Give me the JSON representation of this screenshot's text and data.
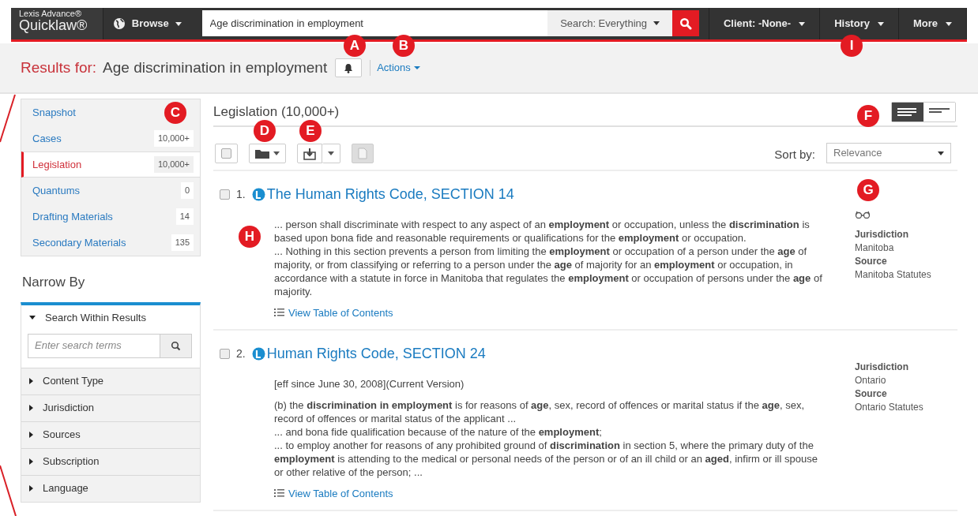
{
  "header": {
    "logo_line1": "Lexis Advance®",
    "logo_line2": "Quicklaw®",
    "browse": "Browse",
    "search_value": "Age discrimination in employment",
    "search_scope": "Search: Everything",
    "menus": [
      "Client: -None-",
      "History",
      "More"
    ]
  },
  "results_bar": {
    "label": "Results for:",
    "query": "Age discrimination in employment",
    "actions": "Actions"
  },
  "categories": [
    {
      "label": "Snapshot",
      "selected": false
    },
    {
      "label": "Cases",
      "count": "10,000+",
      "selected": false
    },
    {
      "label": "Legislation",
      "count": "10,000+",
      "selected": true
    },
    {
      "label": "Quantums",
      "count": "0",
      "selected": false
    },
    {
      "label": "Drafting Materials",
      "count": "14",
      "selected": false
    },
    {
      "label": "Secondary Materials",
      "count": "135",
      "selected": false
    }
  ],
  "narrow_by": {
    "title": "Narrow By",
    "search_placeholder": "Enter search terms",
    "sections": [
      {
        "label": "Search Within Results",
        "expanded": true
      },
      {
        "label": "Content Type",
        "expanded": false
      },
      {
        "label": "Jurisdiction",
        "expanded": false
      },
      {
        "label": "Sources",
        "expanded": false
      },
      {
        "label": "Subscription",
        "expanded": false
      },
      {
        "label": "Language",
        "expanded": false
      }
    ]
  },
  "results_header": {
    "title": "Legislation (10,000+)",
    "sort_label": "Sort by:",
    "sort_value": "Relevance",
    "views": [
      {
        "kind": "full",
        "selected": true
      },
      {
        "kind": "list",
        "selected": false
      }
    ]
  },
  "results": [
    {
      "number": "1.",
      "title": "The Human Rights Code, SECTION 14",
      "checked": false,
      "has_preview": true,
      "snippets": [
        "... person shall discriminate with respect to any aspect of an **employment** or occupation, unless the **discrimination** is based upon bona fide and reasonable requirements or qualifications for the **employment** or occupation.",
        "... Nothing in this section prevents a person from limiting the **employment** or occupation of a person under the **age** of majority, or from classifying or referring to a person under the **age** of majority for an **employment** or occupation, in accordance with a statute in force in Manitoba that regulates the **employment** or occupation of persons under the **age** of majority."
      ],
      "toc": "View Table of Contents",
      "meta": [
        "Jurisdiction",
        "Manitoba",
        "Source",
        "Manitoba Statutes"
      ]
    },
    {
      "number": "2.",
      "title": "Human Rights Code, SECTION 24",
      "checked": false,
      "has_preview": false,
      "version": "[eff since June 30, 2008](Current Version)",
      "snippets": [
        "(b) the **discrimination in employment** is for reasons of **age**, sex, record of offences or marital status if the **age**, sex, record of offences or marital status of the applicant ...",
        "... and bona fide qualification because of the nature of the **employment**;",
        "... to employ another for reasons of any prohibited ground of **discrimination** in section 5, where the primary duty of the **employment** is attending to the medical or personal needs of the person or of an ill child or an **aged**, infirm or ill spouse or other relative of the person; ..."
      ],
      "toc": "View Table of Contents",
      "meta": [
        "Jurisdiction",
        "Ontario",
        "Source",
        "Ontario Statutes"
      ]
    }
  ],
  "callouts": [
    "A",
    "B",
    "I",
    "C",
    "D",
    "E",
    "F",
    "G",
    "H"
  ]
}
